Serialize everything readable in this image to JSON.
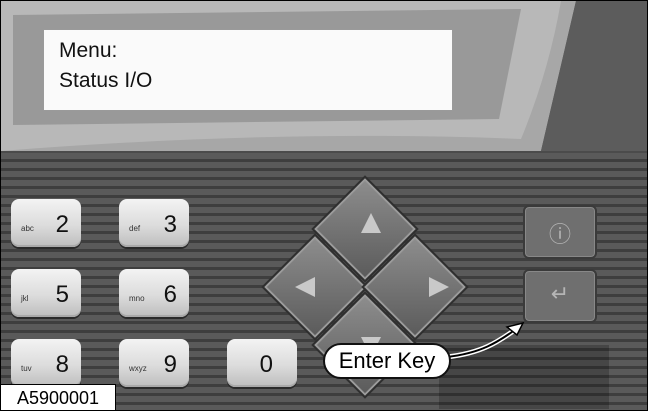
{
  "display": {
    "line1": "Menu:",
    "line2": "Status I/O"
  },
  "keypad": [
    {
      "small": "abc",
      "big": "2"
    },
    {
      "small": "def",
      "big": "3"
    },
    {
      "small": "jkl",
      "big": "5"
    },
    {
      "small": "mno",
      "big": "6"
    },
    {
      "small": "tuv",
      "big": "8"
    },
    {
      "small": "wxyz",
      "big": "9"
    },
    {
      "small": "",
      "big": "0"
    }
  ],
  "dpad": [
    "up-icon",
    "left-icon",
    "right-icon",
    "down-icon"
  ],
  "side_buttons": [
    "info-icon",
    "enter-icon"
  ],
  "callout": {
    "label": "Enter Key"
  },
  "figure": {
    "id": "A5900001"
  },
  "colors": {
    "panel": "#9a9a9a",
    "lcd": "#fafafa",
    "rib": "#4b4b4b",
    "key": "#e2e2e2"
  }
}
